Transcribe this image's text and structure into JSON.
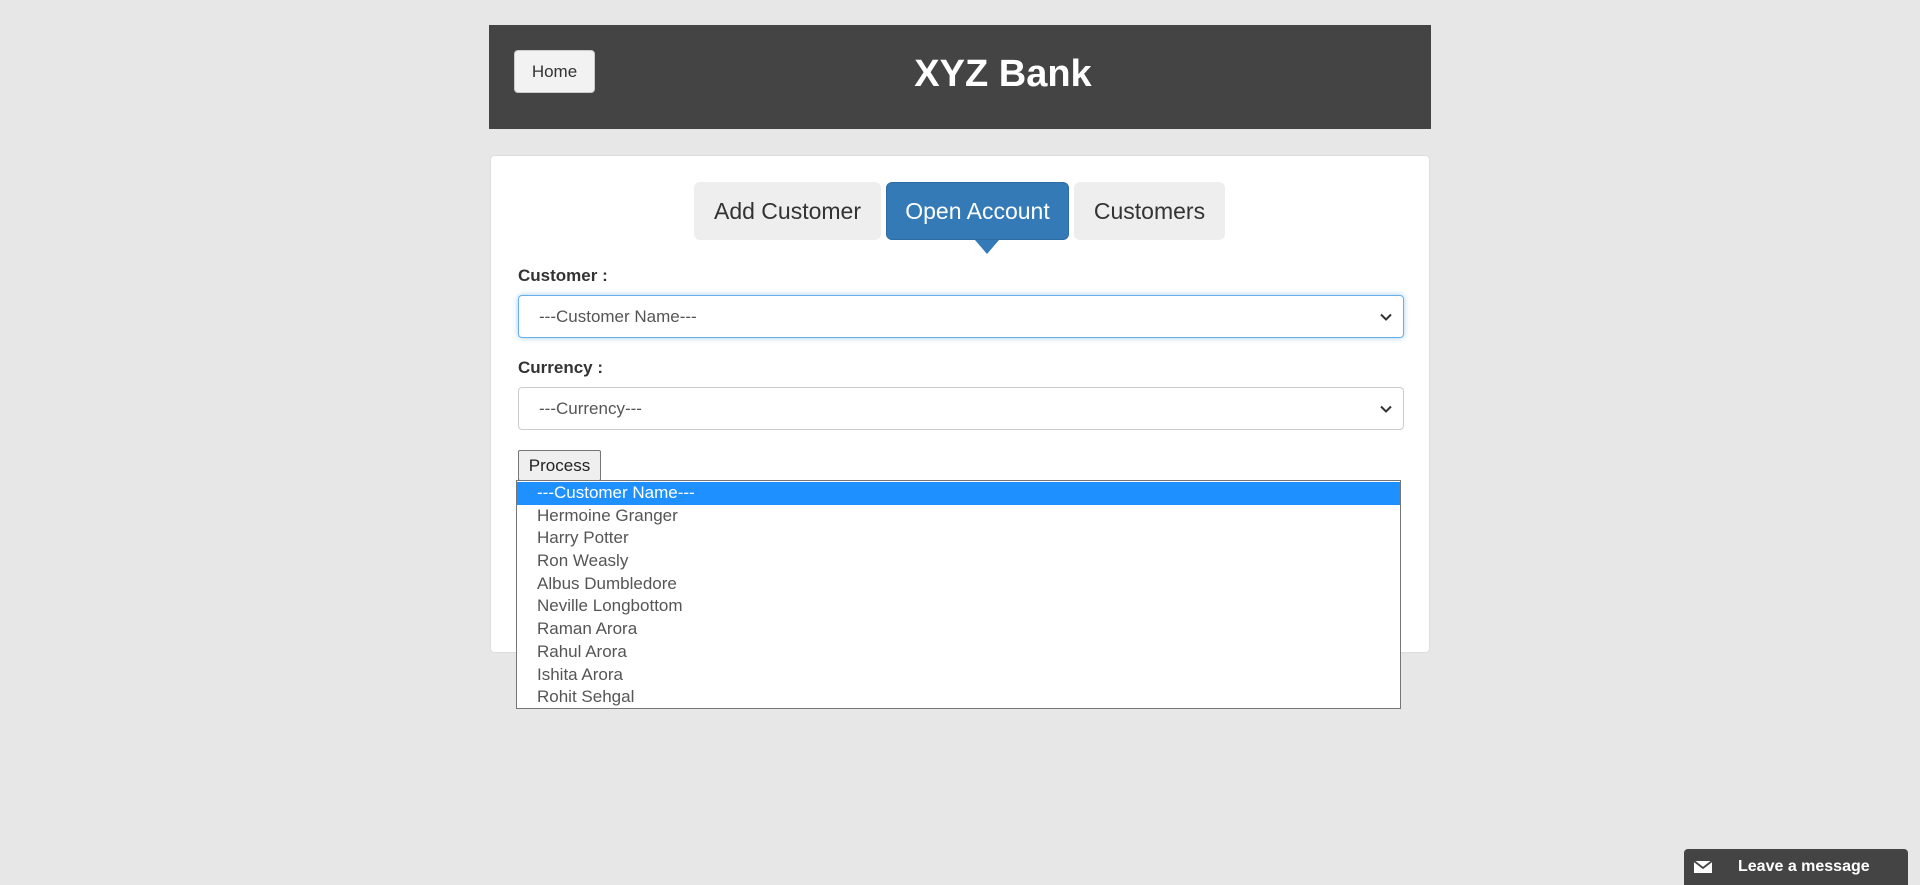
{
  "header": {
    "home_label": "Home",
    "brand_title": "XYZ Bank"
  },
  "tabs": [
    {
      "label": "Add Customer",
      "active": false
    },
    {
      "label": "Open Account",
      "active": true
    },
    {
      "label": "Customers",
      "active": false
    }
  ],
  "form": {
    "customer_label": "Customer :",
    "customer_selected": "---Customer Name---",
    "currency_label": "Currency :",
    "currency_selected": "---Currency---",
    "process_label": "Process"
  },
  "customer_options": [
    "---Customer Name---",
    "Hermoine Granger",
    "Harry Potter",
    "Ron Weasly",
    "Albus Dumbledore",
    "Neville Longbottom",
    "Raman Arora",
    "Rahul Arora",
    "Ishita Arora",
    "Rohit Sehgal"
  ],
  "chat": {
    "label": "Leave a message",
    "icon": "envelope-icon"
  },
  "colors": {
    "header_bg": "#444444",
    "active_tab": "#337ab7",
    "selected_option": "#1e90ff"
  }
}
